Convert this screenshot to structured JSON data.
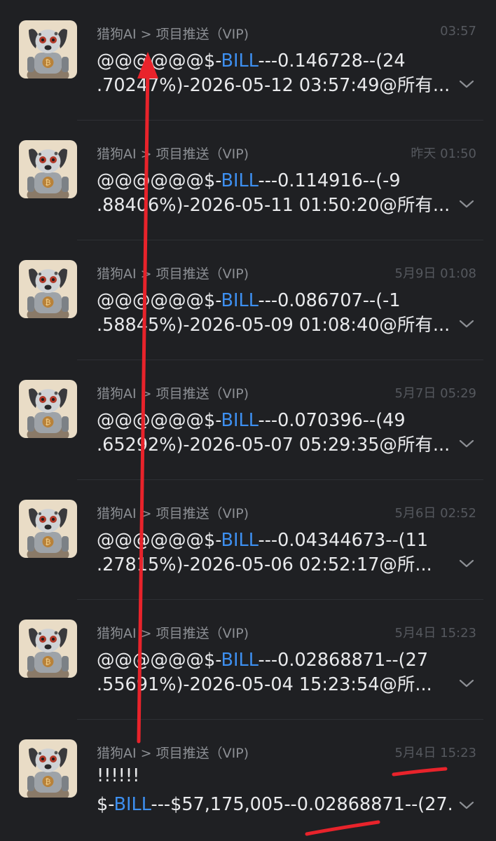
{
  "conversation": {
    "messages": [
      {
        "source": "猎狗AI > 项目推送（VIP)",
        "time": "03:57",
        "line1_pre": "@@@@@@$-",
        "ticker": "BILL",
        "line1_post": "---0.146728--(24",
        "line2": ".70247%)-2026-05-12 03:57:49@所有..."
      },
      {
        "source": "猎狗AI > 项目推送（VIP)",
        "time": "昨天 01:50",
        "line1_pre": "@@@@@@$-",
        "ticker": "BILL",
        "line1_post": "---0.114916--(-9",
        "line2": ".88406%)-2026-05-11 01:50:20@所有..."
      },
      {
        "source": "猎狗AI > 项目推送（VIP)",
        "time": "5月9日 01:08",
        "line1_pre": "@@@@@@$-",
        "ticker": "BILL",
        "line1_post": "---0.086707--(-1",
        "line2": ".58845%)-2026-05-09 01:08:40@所有..."
      },
      {
        "source": "猎狗AI > 项目推送（VIP)",
        "time": "5月7日 05:29",
        "line1_pre": "@@@@@@$-",
        "ticker": "BILL",
        "line1_post": "---0.070396--(49",
        "line2": ".65292%)-2026-05-07 05:29:35@所有..."
      },
      {
        "source": "猎狗AI > 项目推送（VIP)",
        "time": "5月6日 02:52",
        "line1_pre": "@@@@@@$-",
        "ticker": "BILL",
        "line1_post": "---0.04344673--(11",
        "line2": ".27815%)-2026-05-06 02:52:17@所..."
      },
      {
        "source": "猎狗AI > 项目推送（VIP)",
        "time": "5月4日 15:23",
        "line1_pre": "@@@@@@$-",
        "ticker": "BILL",
        "line1_post": "---0.02868871--(27",
        "line2": ".55691%)-2026-05-04 15:23:54@所..."
      }
    ],
    "last_message": {
      "source": "猎狗AI > 项目推送（VIP)",
      "time": "5月4日 15:23",
      "line1": "!!!!!!",
      "line2_pre": "$-",
      "ticker": "BILL",
      "line2_post": "---$57,175,005--0.02868871--(27."
    }
  },
  "colors": {
    "background": "#1f2023",
    "link": "#3d8ff0",
    "annotation": "#e8232b"
  },
  "icons": {
    "avatar": "robot-dog-avatar",
    "expand": "chevron-down-icon"
  }
}
